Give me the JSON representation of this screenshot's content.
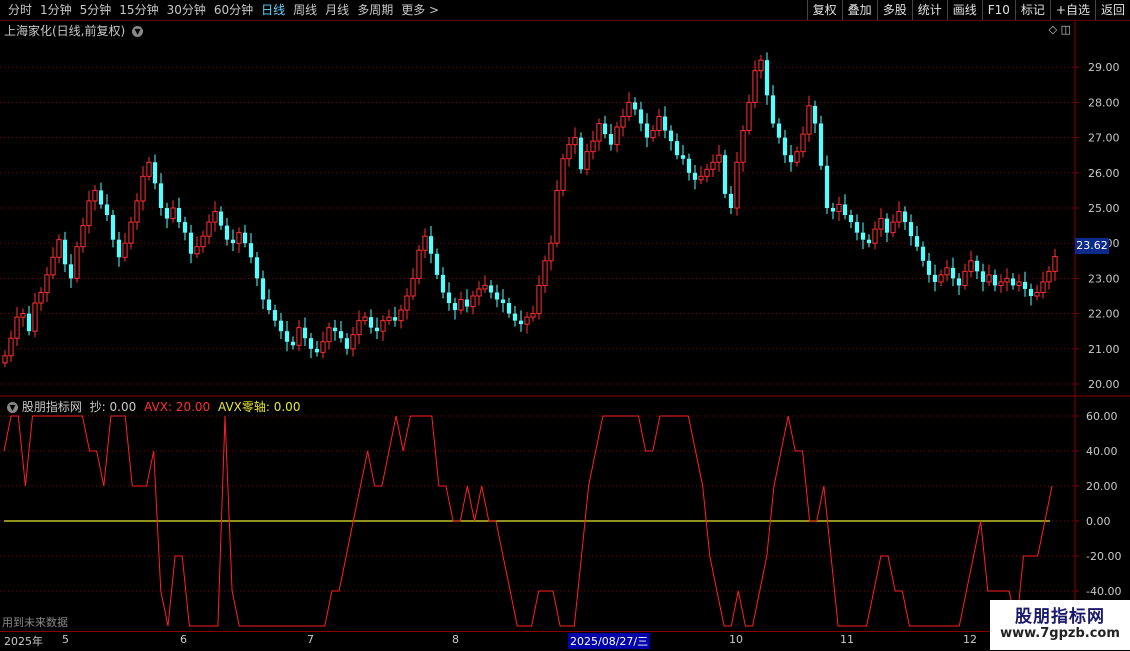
{
  "toolbar": {
    "periods": [
      "分时",
      "1分钟",
      "5分钟",
      "15分钟",
      "30分钟",
      "60分钟",
      "日线",
      "周线",
      "月线",
      "多周期",
      "更多 >"
    ],
    "active_period": "日线",
    "actions": [
      "复权",
      "叠加",
      "多股",
      "统计",
      "画线",
      "F10",
      "标记",
      "+自选",
      "返回"
    ]
  },
  "stock": {
    "title": "上海家化(日线,前复权)",
    "last_price_tag": "23.62"
  },
  "price_axis": {
    "ticks": [
      "29.00",
      "28.00",
      "27.00",
      "26.00",
      "25.00",
      "24.00",
      "23.00",
      "22.00",
      "21.00",
      "20.00"
    ]
  },
  "indicator": {
    "name": "股朋指标网",
    "chao_label": "抄: 0.00",
    "avx_label": "AVX: 20.00",
    "zero_label": "AVX零轴: 0.00",
    "axis_ticks": [
      "60.00",
      "40.00",
      "20.00",
      "0.00",
      "-20.00",
      "-40.00"
    ]
  },
  "future_note": "用到未来数据",
  "x_axis": {
    "labels": [
      "2025年",
      "5",
      "6",
      "7",
      "8",
      "2025/08/27/三",
      "10",
      "11",
      "12"
    ]
  },
  "watermark": {
    "line1": "股朋指标网",
    "line2": "www.7gpzb.com"
  },
  "colors": {
    "up": "#ff3030",
    "down": "#54ffff",
    "avx": "#ff2020",
    "zero": "#e8e830",
    "grid": "#8b0000"
  },
  "chart_data": [
    {
      "type": "candlestick",
      "title": "上海家化(日线,前复权)",
      "ylim": [
        20.0,
        29.6
      ],
      "x_labels": [
        "2025年",
        "5",
        "6",
        "7",
        "8",
        "2025/08/27/三",
        "10",
        "11",
        "12"
      ],
      "series": [
        {
          "close": [
            20.8,
            21.3,
            21.9,
            22.0,
            21.5,
            22.3,
            22.6,
            23.1,
            23.6,
            24.1,
            23.4,
            23.0,
            23.9,
            24.5,
            25.2,
            25.5,
            25.1,
            24.8,
            24.1,
            23.6,
            24.0,
            24.6,
            25.2,
            25.9,
            26.3,
            25.7,
            25.0,
            24.7,
            25.0,
            24.6,
            24.3,
            23.7,
            23.9,
            24.2,
            24.6,
            24.9,
            24.5,
            24.1,
            24.0,
            24.3,
            24.0,
            23.6,
            23.0,
            22.4,
            22.1,
            21.8,
            21.5,
            21.2,
            21.1,
            21.6,
            21.3,
            21.0,
            20.9,
            21.2,
            21.6,
            21.5,
            21.3,
            21.0,
            21.4,
            21.8,
            21.9,
            21.6,
            21.5,
            21.8,
            21.9,
            21.8,
            22.1,
            22.5,
            23.0,
            23.8,
            24.2,
            23.7,
            23.1,
            22.6,
            22.3,
            22.1,
            22.4,
            22.2,
            22.5,
            22.7,
            22.8,
            22.6,
            22.4,
            22.3,
            22.0,
            21.8,
            21.7,
            21.9,
            22.0,
            22.8,
            23.5,
            24.0,
            25.5,
            26.4,
            26.8,
            27.0,
            26.1,
            26.6,
            26.9,
            27.4,
            27.1,
            26.8,
            27.3,
            27.6,
            28.0,
            27.8,
            27.4,
            27.0,
            27.2,
            27.6,
            27.2,
            26.9,
            26.5,
            26.4,
            26.0,
            25.8,
            25.9,
            26.1,
            26.3,
            26.5,
            25.4,
            25.0,
            26.3,
            27.2,
            28.0,
            28.9,
            29.2,
            28.2,
            27.4,
            27.0,
            26.5,
            26.3,
            26.6,
            27.1,
            27.9,
            27.4,
            26.2,
            25.0,
            24.9,
            25.1,
            24.8,
            24.6,
            24.3,
            24.1,
            24.0,
            24.4,
            24.7,
            24.3,
            24.6,
            24.9,
            24.6,
            24.2,
            23.9,
            23.5,
            23.1,
            22.9,
            23.1,
            23.3,
            23.0,
            22.8,
            23.2,
            23.5,
            23.2,
            22.9,
            23.1,
            22.8,
            22.9,
            23.0,
            22.8,
            22.9,
            22.7,
            22.5,
            22.6,
            22.9,
            23.2,
            23.62
          ]
        }
      ]
    },
    {
      "type": "line",
      "title": "股朋指标网",
      "ylim": [
        -40,
        60
      ],
      "series": [
        {
          "name": "AVX",
          "values": [
            40,
            60,
            60,
            20,
            60,
            60,
            60,
            60,
            60,
            60,
            60,
            60,
            40,
            40,
            20,
            60,
            60,
            60,
            20,
            20,
            20,
            40,
            -40,
            -60,
            -20,
            -20,
            -60,
            -60,
            -60,
            -60,
            -60,
            60,
            -40,
            -60,
            -60,
            -60,
            -60,
            -60,
            -60,
            -60,
            -60,
            -60,
            -60,
            -60,
            -60,
            -60,
            -40,
            -40,
            -20,
            0,
            20,
            40,
            20,
            20,
            40,
            60,
            40,
            60,
            60,
            60,
            60,
            20,
            20,
            0,
            0,
            20,
            0,
            20,
            0,
            0,
            -20,
            -40,
            -60,
            -60,
            -60,
            -40,
            -40,
            -40,
            -60,
            -60,
            -60,
            -20,
            20,
            40,
            60,
            60,
            60,
            60,
            60,
            60,
            40,
            40,
            60,
            60,
            60,
            60,
            60,
            40,
            20,
            -20,
            -40,
            -60,
            -60,
            -40,
            -60,
            -60,
            -40,
            -20,
            20,
            40,
            60,
            40,
            40,
            0,
            0,
            20,
            -20,
            -60,
            -60,
            -60,
            -60,
            -60,
            -40,
            -20,
            -20,
            -40,
            -40,
            -60,
            -60,
            -60,
            -60,
            -60,
            -60,
            -60,
            -60,
            -40,
            -20,
            0,
            -40,
            -40,
            -40,
            -40,
            -60,
            -20,
            -20,
            -20,
            0,
            20
          ]
        },
        {
          "name": "AVX零轴",
          "values": [
            0
          ]
        }
      ]
    }
  ]
}
